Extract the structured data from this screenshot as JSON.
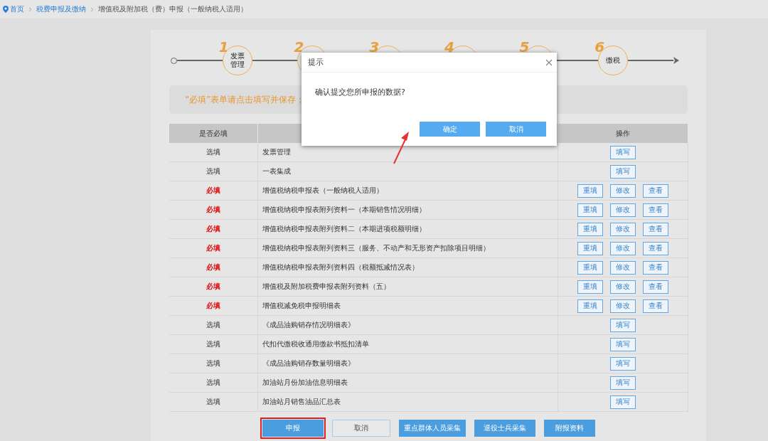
{
  "breadcrumb": [
    {
      "label": "首页",
      "kind": "home"
    },
    {
      "label": "税费申报及缴纳",
      "kind": "link"
    },
    {
      "label": "增值税及附加税（费）申报（一般纳税人适用）",
      "kind": "current"
    }
  ],
  "steps": [
    {
      "number": "1",
      "label": "发票管理"
    },
    {
      "number": "2"
    },
    {
      "number": "3"
    },
    {
      "number": "4"
    },
    {
      "number": "5"
    },
    {
      "number": "6",
      "label": "缴税"
    }
  ],
  "notice": "“必填”表单请点击填写并保存；",
  "table": {
    "columns": [
      "是否必填",
      "操作"
    ],
    "rows": [
      {
        "required": false,
        "status": "选填",
        "name": "发票管理",
        "actions": [
          "填写"
        ]
      },
      {
        "required": false,
        "status": "选填",
        "name": "一表集成",
        "actions": [
          "填写"
        ]
      },
      {
        "required": true,
        "status": "必填",
        "name": "增值税纳税申报表（一般纳税人适用）",
        "actions": [
          "重填",
          "修改",
          "查看"
        ]
      },
      {
        "required": true,
        "status": "必填",
        "name": "增值税纳税申报表附列资料一（本期销售情况明细）",
        "actions": [
          "重填",
          "修改",
          "查看"
        ]
      },
      {
        "required": true,
        "status": "必填",
        "name": "增值税纳税申报表附列资料二（本期进项税额明细）",
        "actions": [
          "重填",
          "修改",
          "查看"
        ]
      },
      {
        "required": true,
        "status": "必填",
        "name": "增值税纳税申报表附列资料三（服务、不动产和无形资产扣除项目明细）",
        "actions": [
          "重填",
          "修改",
          "查看"
        ]
      },
      {
        "required": true,
        "status": "必填",
        "name": "增值税纳税申报表附列资料四（税额抵减情况表）",
        "actions": [
          "重填",
          "修改",
          "查看"
        ]
      },
      {
        "required": true,
        "status": "必填",
        "name": "增值税及附加税费申报表附列资料（五）",
        "actions": [
          "重填",
          "修改",
          "查看"
        ]
      },
      {
        "required": true,
        "status": "必填",
        "name": "增值税减免税申报明细表",
        "actions": [
          "重填",
          "修改",
          "查看"
        ]
      },
      {
        "required": false,
        "status": "选填",
        "name": "《成品油购销存情况明细表》",
        "actions": [
          "填写"
        ]
      },
      {
        "required": false,
        "status": "选填",
        "name": "代扣代缴税收通用缴款书抵扣清单",
        "actions": [
          "填写"
        ]
      },
      {
        "required": false,
        "status": "选填",
        "name": "《成品油购销存数量明细表》",
        "actions": [
          "填写"
        ]
      },
      {
        "required": false,
        "status": "选填",
        "name": "加油站月份加油信息明细表",
        "actions": [
          "填写"
        ]
      },
      {
        "required": false,
        "status": "选填",
        "name": "加油站月销售油品汇总表",
        "actions": [
          "填写"
        ]
      }
    ]
  },
  "footer_buttons": [
    {
      "label": "申报",
      "kind": "primary",
      "highlighted": true
    },
    {
      "label": "取消",
      "kind": "outline",
      "highlighted": false
    },
    {
      "label": "重点群体人员采集",
      "kind": "primary",
      "highlighted": false
    },
    {
      "label": "退役士兵采集",
      "kind": "primary",
      "highlighted": false
    },
    {
      "label": "附报资料",
      "kind": "primary",
      "highlighted": false
    }
  ],
  "dialog": {
    "title": "提示",
    "message": "确认提交您所申报的数据?",
    "buttons": [
      "确定",
      "取消"
    ]
  }
}
